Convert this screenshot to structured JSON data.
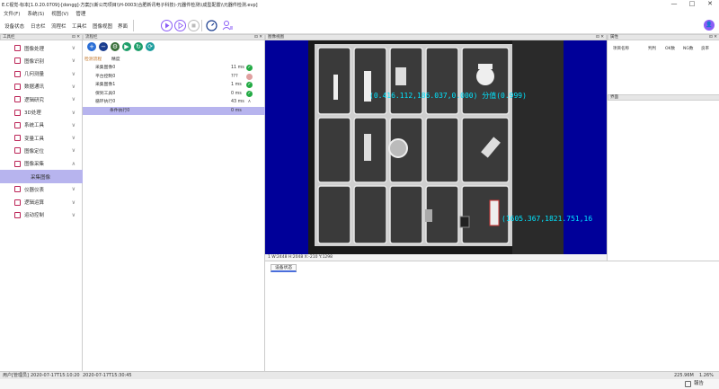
{
  "window": {
    "title": "E.C视觉-标本[1.0.20.0709]-[dongg]-方案[\\\\新公司项目\\\\H-0003(合肥新讯电子科技)-元器件检测\\\\成型配置\\\\元器件检测.evp]",
    "minimize": "—",
    "maximize": "□",
    "close": "✕"
  },
  "menu": [
    "文件(F)",
    "系统(S)",
    "视图(V)",
    "管理"
  ],
  "toolbar": {
    "tabs": [
      "设备状态",
      "日志栏",
      "流程栏",
      "工具栏",
      "图像视图",
      "界面"
    ],
    "avatar": "👤"
  },
  "left_panel": {
    "title": "工具栏",
    "pin": "⊡ ✕",
    "items": [
      {
        "label": "图像处理",
        "chev": "∨"
      },
      {
        "label": "图像识别",
        "chev": "∨"
      },
      {
        "label": "几何测量",
        "chev": "∨"
      },
      {
        "label": "数据通讯",
        "chev": "∨"
      },
      {
        "label": "逻辑研究",
        "chev": "∨"
      },
      {
        "label": "3D处理",
        "chev": "∨"
      },
      {
        "label": "系统工具",
        "chev": "∨"
      },
      {
        "label": "变量工具",
        "chev": "∨"
      },
      {
        "label": "图像定位",
        "chev": "∨"
      },
      {
        "label": "图像采集",
        "chev": "∧"
      },
      {
        "label": "采集图像",
        "chev": ""
      },
      {
        "label": "仪器仪表",
        "chev": "∨"
      },
      {
        "label": "逻辑运算",
        "chev": "∨"
      },
      {
        "label": "运动控制",
        "chev": "∨"
      }
    ]
  },
  "process_panel": {
    "title": "流程栏",
    "pin": "⊡ ✕",
    "tabs": [
      "检测流程",
      "精度"
    ],
    "rows": [
      {
        "name": "采集图像0",
        "ms": "11 ms",
        "status": "ok"
      },
      {
        "name": "平台控制0",
        "ms": "???",
        "status": "warn"
      },
      {
        "name": "采集图像1",
        "ms": "1 ms",
        "status": "ok"
      },
      {
        "name": "保到工具0",
        "ms": "0 ms",
        "status": "ok"
      },
      {
        "name": "循环执行0",
        "ms": "43 ms",
        "status": "exp"
      },
      {
        "name": "条件执行0",
        "ms": "0 ms",
        "status": "none"
      }
    ]
  },
  "image_view": {
    "title": "图像视图",
    "pin": "⊡ ✕",
    "overlay1": "(0.416.112,186.037,0.000) 分值(0.999)",
    "overlay2": "(1605.367,1821.751,16",
    "status": "1  W:2448 H:2048 X:-210 Y:1298"
  },
  "props_panel": {
    "title": "属性",
    "pin": "⊡ ✕",
    "columns": [
      "项目名称",
      "判判",
      "OK数",
      "NG数",
      "良率"
    ],
    "title2": "界面"
  },
  "device_panel": {
    "tab": "设备状态"
  },
  "statusbar": {
    "user": "用户[管理员]",
    "time1": "2020-07-17T15:10:20",
    "time2": "2020-07-17T15:30:45",
    "memory": "225.96M",
    "cpu": "1.26%"
  },
  "bottom": {
    "right_label": "報告"
  },
  "colors": {
    "accent": "#b7b4ee",
    "canvas_bg": "#000099",
    "ok": "#22aa44",
    "overlay": "#00e5ff"
  }
}
